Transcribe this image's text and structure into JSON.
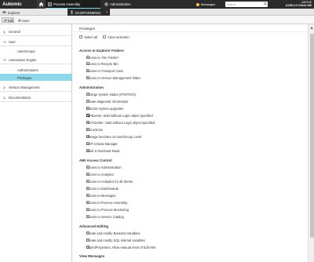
{
  "topbar": {
    "logo": "Automic",
    "tabs": [
      {
        "label": "Process Assembly",
        "icon": "puzzle-icon",
        "active": true
      },
      {
        "label": "Administration",
        "icon": "gears-icon",
        "active": false
      }
    ],
    "messages_label": "Messages",
    "search_placeholder": "Search",
    "system_line1": "NATIVE",
    "system_line2": "A11ELLV Client 100"
  },
  "doc_tabs": {
    "explorer_label": "Explorer",
    "active_label": "EXISPONNENE2"
  },
  "toolbar": {
    "edit_label": "Edit",
    "save_label": "Save"
  },
  "sidebar": {
    "groups": [
      {
        "label": "General",
        "icon": "info-icon"
      },
      {
        "label": "User",
        "icon": "user-icon"
      },
      {
        "label": "Automation Engine",
        "icon": "engine-icon"
      },
      {
        "label": "Version Management",
        "icon": "version-icon"
      },
      {
        "label": "Documentation",
        "icon": "document-icon"
      }
    ],
    "subitems": {
      "user_groups": "UserGroups",
      "authorizations": "Authorizations",
      "privileges": "Privileges"
    }
  },
  "content": {
    "heading": "Privileges",
    "select_all": "Select all",
    "clear_selection": "Clear selection",
    "sections": [
      {
        "title": "Access to Explorer Folders",
        "items": [
          {
            "label": "Access to <No Folder>",
            "checked": false
          },
          {
            "label": "Access to Recycle Bin",
            "checked": false
          },
          {
            "label": "Access to Transport Case",
            "checked": false
          },
          {
            "label": "Access to Version Management folder",
            "checked": false
          }
        ]
      },
      {
        "title": "Administration",
        "items": [
          {
            "label": "Change system status (STOP/GO)",
            "checked": false
          },
          {
            "label": "Create diagnostic information",
            "checked": false
          },
          {
            "label": "Execute system upgrades",
            "checked": false
          },
          {
            "label": "FileEvents: Start without Login object specified",
            "checked": true
          },
          {
            "label": "FileTransfer: Start without Login object specified",
            "checked": false
          },
          {
            "label": "Exit actions",
            "checked": false
          },
          {
            "label": "Manage favorites on User/Group Level",
            "checked": false
          },
          {
            "label": "SAP Criteria Manager",
            "checked": false
          },
          {
            "label": "Work in Runbook Mode",
            "checked": false
          }
        ]
      },
      {
        "title": "AWI Access Control",
        "items": [
          {
            "label": "Access to Administration",
            "checked": false
          },
          {
            "label": "Access to Analytics",
            "checked": false
          },
          {
            "label": "Access to Analytics for all clients",
            "checked": false
          },
          {
            "label": "Access to Dashboards",
            "checked": false
          },
          {
            "label": "Access to Messages",
            "checked": false
          },
          {
            "label": "Access to Process Assembly",
            "checked": false
          },
          {
            "label": "Access to Process Monitoring",
            "checked": false
          },
          {
            "label": "Access to Service Catalog",
            "checked": false
          }
        ]
      },
      {
        "title": "Advanced Editing",
        "items": [
          {
            "label": "Create and modify Backend Variables",
            "checked": false
          },
          {
            "label": "Create and modify SQL internal variables",
            "checked": false
          },
          {
            "label": "ObjectProperties: Allow manual reset of Edit Hint",
            "checked": false
          }
        ]
      },
      {
        "title": "View Messages",
        "items": []
      }
    ]
  }
}
